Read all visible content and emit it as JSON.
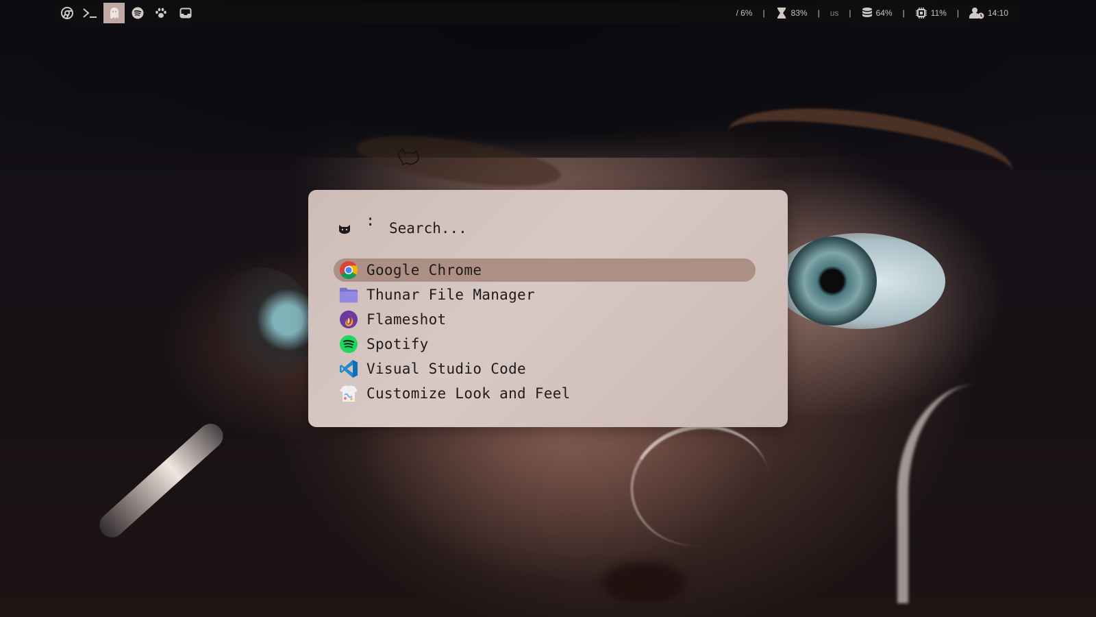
{
  "topbar": {
    "workspaces": [
      {
        "icon": "chrome-icon",
        "active": false
      },
      {
        "icon": "terminal-icon",
        "active": false
      },
      {
        "icon": "ghost-icon",
        "active": true
      },
      {
        "icon": "spotify-icon",
        "active": false
      },
      {
        "icon": "paw-icon",
        "active": false
      },
      {
        "icon": "inbox-icon",
        "active": false
      }
    ],
    "status": {
      "disk": "/ 6%",
      "battery": "83%",
      "keyboard_layout": "us",
      "storage": "64%",
      "cpu": "11%",
      "time": "14:10"
    },
    "separator": "|",
    "accent": "#c0a9a4"
  },
  "launcher": {
    "prompt_symbol": ":",
    "search_placeholder": "Search...",
    "items": [
      {
        "label": "Google Chrome",
        "icon": "chrome-icon",
        "selected": true
      },
      {
        "label": "Thunar File Manager",
        "icon": "folder-icon",
        "selected": false
      },
      {
        "label": "Flameshot",
        "icon": "flameshot-icon",
        "selected": false
      },
      {
        "label": "Spotify",
        "icon": "spotify-icon",
        "selected": false
      },
      {
        "label": "Visual Studio Code",
        "icon": "vscode-icon",
        "selected": false
      },
      {
        "label": "Customize Look and Feel",
        "icon": "look-and-feel-icon",
        "selected": false
      }
    ],
    "colors": {
      "background": "#d3c3bd",
      "selected": "#ad9085",
      "text": "#1f1a1a"
    }
  }
}
